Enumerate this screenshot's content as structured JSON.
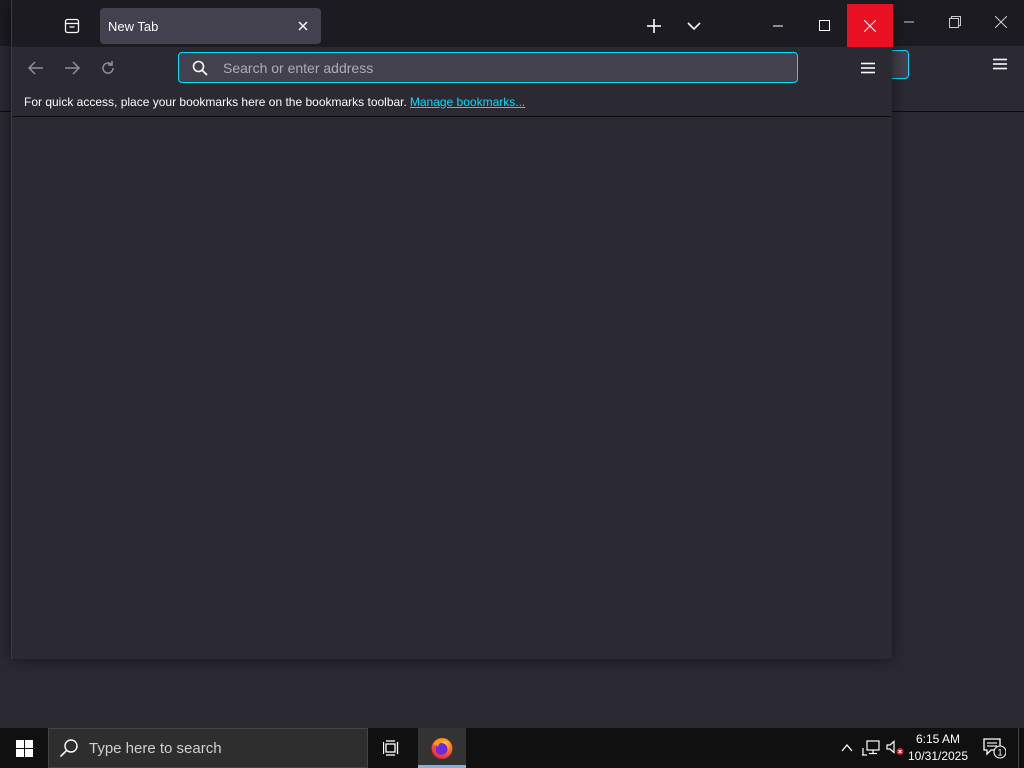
{
  "browser": {
    "tab": {
      "title": "New Tab",
      "close_icon": "close-icon"
    },
    "toolbar": {
      "urlbar_placeholder": "Search or enter address",
      "icons": [
        "back-arrow-icon",
        "forward-arrow-icon",
        "reload-icon",
        "search-icon",
        "hamburger-menu-icon"
      ]
    },
    "bookmarks_bar": {
      "message": "For quick access, place your bookmarks here on the bookmarks toolbar.",
      "link": "Manage bookmarks..."
    },
    "window_controls": [
      "minimize-icon",
      "maximize-icon",
      "close-icon"
    ]
  },
  "taskbar": {
    "search_placeholder": "Type here to search",
    "clock": {
      "time": "6:15 AM",
      "date": "10/31/2025"
    },
    "notification_count": "1",
    "pinned": [
      "firefox-icon"
    ]
  },
  "colors": {
    "accent": "#00ddff",
    "close_hover": "#e81123",
    "titlebar": "#1c1b22",
    "toolbar": "#2b2a33",
    "urlbar": "#42414d",
    "taskbar": "#101010",
    "taskbar_active": "#7cb4e6"
  }
}
